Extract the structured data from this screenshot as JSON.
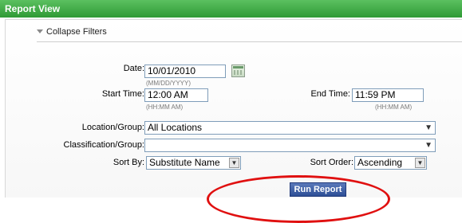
{
  "window": {
    "title": "Report View"
  },
  "filters": {
    "collapse_label": "Collapse Filters",
    "date_label": "Date:",
    "date_value": "10/01/2010",
    "date_hint": "(MM/DD/YYYY)",
    "start_time_label": "Start Time:",
    "start_time_value": "12:00 AM",
    "start_time_hint": "(HH:MM AM)",
    "end_time_label": "End Time:",
    "end_time_value": "11:59 PM",
    "end_time_hint": "(HH:MM AM)",
    "location_label": "Location/Group:",
    "location_value": "All Locations",
    "classification_label": "Classification/Group:",
    "classification_value": "",
    "sort_by_label": "Sort By:",
    "sort_by_value": "Substitute Name",
    "sort_order_label": "Sort Order:",
    "sort_order_value": "Ascending"
  },
  "actions": {
    "run_report_label": "Run Report"
  },
  "icons": {
    "collapse": "triangle-down-icon",
    "calendar": "calendar-icon",
    "dropdown": "chevron-down-icon"
  },
  "colors": {
    "titlebar": "#3aa53f",
    "button": "#3b5ea6",
    "highlight": "#e01010"
  }
}
